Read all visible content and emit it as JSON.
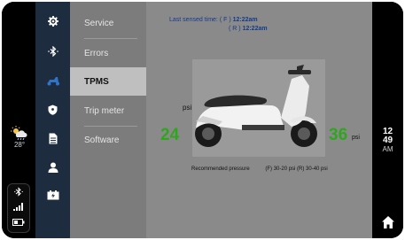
{
  "left_rail": {
    "weather": {
      "icon": "sun-rain-cloud-icon",
      "temperature": "28°"
    },
    "status": [
      {
        "icon": "bluetooth-icon"
      },
      {
        "icon": "signal-bars-icon"
      },
      {
        "icon": "battery-icon"
      }
    ]
  },
  "icon_column": {
    "items": [
      {
        "name": "settings-gear-icon"
      },
      {
        "name": "bluetooth-icon"
      },
      {
        "name": "scooter-icon",
        "active": true
      },
      {
        "name": "shield-icon"
      },
      {
        "name": "document-icon"
      },
      {
        "name": "user-icon"
      },
      {
        "name": "charging-box-icon"
      }
    ]
  },
  "menu": {
    "items": [
      {
        "label": "Service"
      },
      {
        "label": "Errors"
      },
      {
        "label": "TPMS",
        "active": true
      },
      {
        "label": "Trip meter"
      },
      {
        "label": "Software"
      }
    ]
  },
  "tpms": {
    "last_sensed_label": "Last sensed time:",
    "front_tag": "( F )",
    "front_time": "12:22am",
    "rear_tag": "( R )",
    "rear_time": "12:22am",
    "psi_unit_front": "psi",
    "front_psi": "24",
    "rear_psi": "36",
    "psi_unit_rear": "psi",
    "recommended_label": "Recommended pressure",
    "recommended_values": "(F) 30-20 psi  (R) 30-40 psi",
    "value_color": "#2fa61e"
  },
  "right_rail": {
    "clock_hour": "12",
    "clock_minute": "49",
    "clock_ampm": "AM",
    "home_icon": "home-icon"
  },
  "colors": {
    "nav_bg": "#1d2d3f",
    "menu_bg": "#7c7c7c",
    "menu_active_bg": "#bfbfbf",
    "content_bg": "#8a8a8a",
    "accent_blue": "#163a8a"
  }
}
